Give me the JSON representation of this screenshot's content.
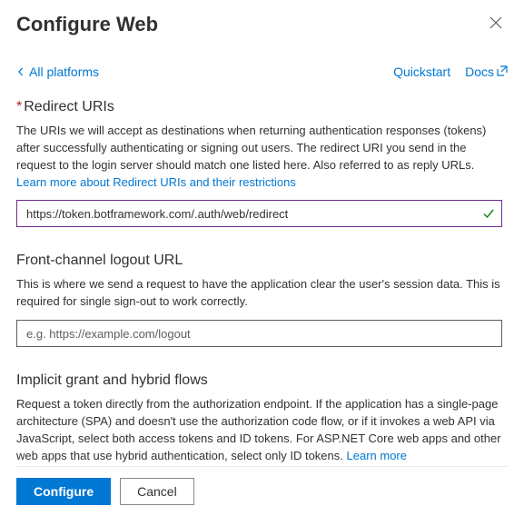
{
  "header": {
    "title": "Configure Web"
  },
  "toolbar": {
    "back": "All platforms",
    "quickstart": "Quickstart",
    "docs": "Docs"
  },
  "sections": {
    "redirect": {
      "title": "Redirect URIs",
      "desc": "The URIs we will accept as destinations when returning authentication responses (tokens) after successfully authenticating or signing out users. The redirect URI you send in the request to the login server should match one listed here. Also referred to as reply URLs.",
      "learn": "Learn more about Redirect URIs and their restrictions",
      "value": "https://token.botframework.com/.auth/web/redirect"
    },
    "logout": {
      "title": "Front-channel logout URL",
      "desc": "This is where we send a request to have the application clear the user's session data. This is required for single sign-out to work correctly.",
      "placeholder": "e.g. https://example.com/logout",
      "value": ""
    },
    "implicit": {
      "title": "Implicit grant and hybrid flows",
      "desc": "Request a token directly from the authorization endpoint. If the application has a single-page architecture (SPA) and doesn't use the authorization code flow, or if it invokes a web API via JavaScript, select both access tokens and ID tokens. For ASP.NET Core web apps and other web apps that use hybrid authentication, select only ID tokens. ",
      "learn": "Learn more"
    }
  },
  "footer": {
    "configure": "Configure",
    "cancel": "Cancel"
  }
}
